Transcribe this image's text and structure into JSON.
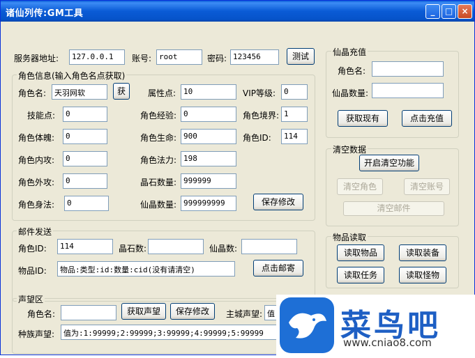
{
  "window": {
    "title": "诸仙列传:GM工具",
    "minimize": "_",
    "maximize": "□",
    "close": "×"
  },
  "server": {
    "addr_label": "服务器地址:",
    "addr": "127.0.0.1",
    "account_label": "账号:",
    "account": "root",
    "password_label": "密码:",
    "password": "123456",
    "test_button": "测试"
  },
  "role": {
    "group_title": "角色信息(输入角色名点获取)",
    "name_label": "角色名:",
    "name": "天羽网软",
    "get_button": "获",
    "attr_label": "属性点:",
    "attr": "10",
    "vip_label": "VIP等级:",
    "vip": "0",
    "skill_label": "技能点:",
    "skill": "0",
    "exp_label": "角色经验:",
    "exp": "0",
    "realm_label": "角色境界:",
    "realm": "1",
    "physique_label": "角色体魄:",
    "physique": "0",
    "hp_label": "角色生命:",
    "hp": "900",
    "id_label": "角色ID:",
    "id": "114",
    "inner_label": "角色内攻:",
    "inner": "0",
    "mp_label": "角色法力:",
    "mp": "198",
    "outer_label": "角色外攻:",
    "outer": "0",
    "crystal_label": "晶石数量:",
    "crystal": "999999",
    "agility_label": "角色身法:",
    "agility": "0",
    "xianjing_label": "仙晶数量:",
    "xianjing": "999999999",
    "save_button": "保存修改"
  },
  "recharge": {
    "group_title": "仙晶充值",
    "name_label": "角色名:",
    "name": "",
    "amount_label": "仙晶数量:",
    "amount": "",
    "fetch_button": "获取现有",
    "recharge_button": "点击充值"
  },
  "clear": {
    "group_title": "清空数据",
    "enable_button": "开启清空功能",
    "clear_role": "清空角色",
    "clear_account": "清空账号",
    "clear_mail": "清空邮件"
  },
  "mail": {
    "group_title": "邮件发送",
    "role_id_label": "角色ID:",
    "role_id": "114",
    "crystal_label": "晶石数:",
    "crystal": "",
    "xianjing_label": "仙晶数:",
    "xianjing": "",
    "item_label": "物品ID:",
    "item": "物品:类型:id:数量:cid(没有请清空)",
    "send_button": "点击邮寄"
  },
  "items": {
    "group_title": "物品读取",
    "read_items": "读取物品",
    "read_equip": "读取装备",
    "read_tasks": "读取任务",
    "read_monsters": "读取怪物"
  },
  "fame": {
    "group_title": "声望区",
    "name_label": "角色名:",
    "name": "",
    "get_button": "获取声望",
    "save_button": "保存修改",
    "city_label": "主城声望:",
    "city": "值",
    "race_label": "种族声望:",
    "race": "值为:1:99999;2:99999;3:99999;4:99999;5:99999"
  },
  "watermark": {
    "brand": "菜鸟吧",
    "url": "www.cniao8.com"
  }
}
